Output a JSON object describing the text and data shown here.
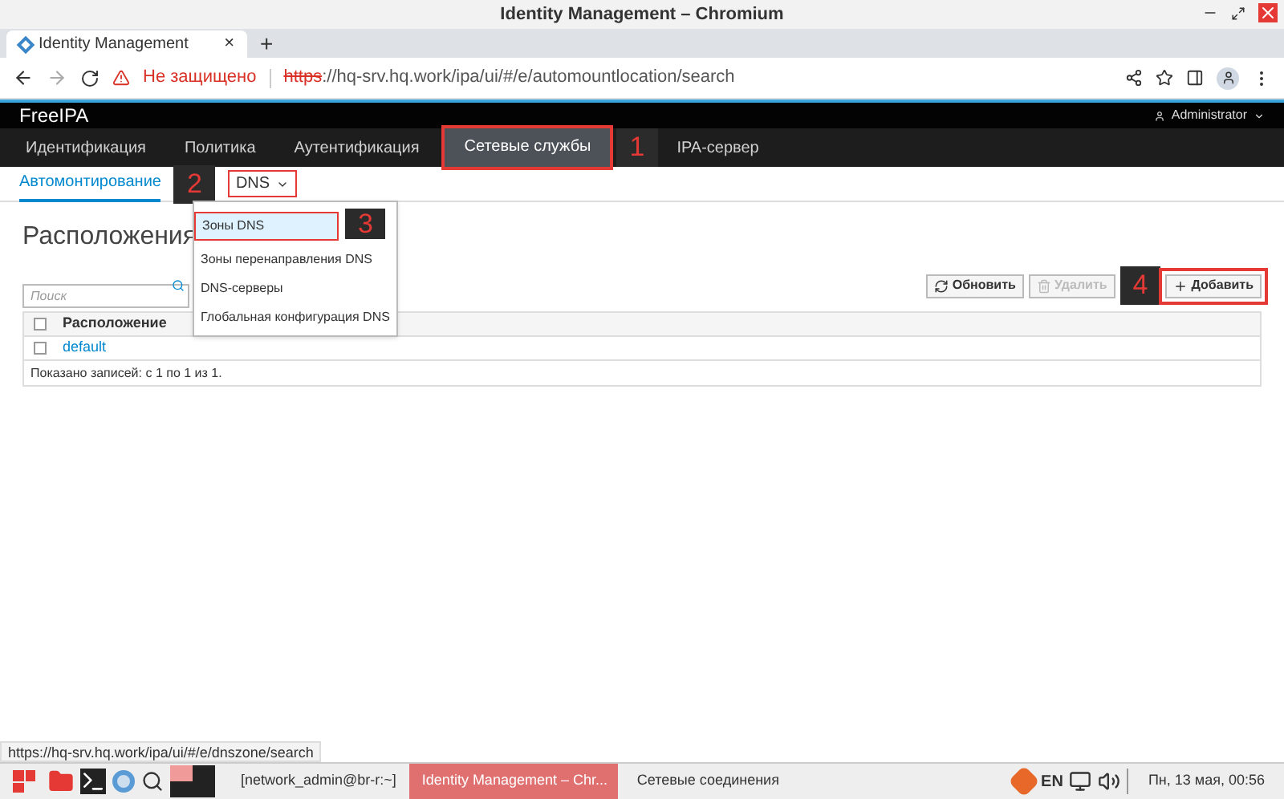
{
  "window": {
    "title": "Identity Management – Chromium"
  },
  "browser_tab": {
    "title": "Identity Management",
    "close": "×",
    "new_tab": "+"
  },
  "address": {
    "warning": "Не защищено",
    "scheme": "https",
    "url": "://hq-srv.hq.work/ipa/ui/#/e/automountlocation/search"
  },
  "header": {
    "logo": "FreeIPA",
    "user": "Administrator"
  },
  "nav": [
    {
      "label": "Идентификация",
      "selected": false
    },
    {
      "label": "Политика",
      "selected": false
    },
    {
      "label": "Аутентификация",
      "selected": false
    },
    {
      "label": "Сетевые службы",
      "selected": true
    },
    {
      "label": "IPA-сервер",
      "selected": false
    }
  ],
  "subnav": [
    {
      "label": "Автомонтирование",
      "selected": true,
      "kind": "link"
    },
    {
      "label": "DNS",
      "selected": false,
      "kind": "menu"
    }
  ],
  "dropdown": [
    {
      "label": "Зоны DNS",
      "selected": true
    },
    {
      "label": "Зоны перенаправления DNS",
      "selected": false
    },
    {
      "label": "DNS-серверы",
      "selected": false
    },
    {
      "label": "Глобальная конфигурация DNS",
      "selected": false
    }
  ],
  "page": {
    "heading": "Расположения",
    "search_placeholder": "Поиск"
  },
  "buttons": [
    {
      "label": "Обновить",
      "disabled": false,
      "kind": "refresh"
    },
    {
      "label": "Удалить",
      "disabled": true,
      "kind": "delete"
    },
    {
      "label": "Добавить",
      "disabled": false,
      "kind": "add"
    }
  ],
  "table": {
    "all_checked": false,
    "columns": [
      "Расположение"
    ],
    "rows": [
      {
        "cells": [
          "default"
        ],
        "checked": false
      }
    ],
    "footer": "Показано записей: с 1 по 1 из 1."
  },
  "markers": [
    "1",
    "2",
    "3",
    "4"
  ],
  "status_url": "https://hq-srv.hq.work/ipa/ui/#/e/dnszone/search",
  "taskbar": {
    "terminal": "[network_admin@br-r:~]",
    "windows": [
      {
        "label": "Identity Management – Chr...",
        "selected": true
      },
      {
        "label": "Сетевые соединения",
        "selected": false
      }
    ],
    "lang": "EN",
    "clock": "Пн, 13 мая, 00:56"
  }
}
